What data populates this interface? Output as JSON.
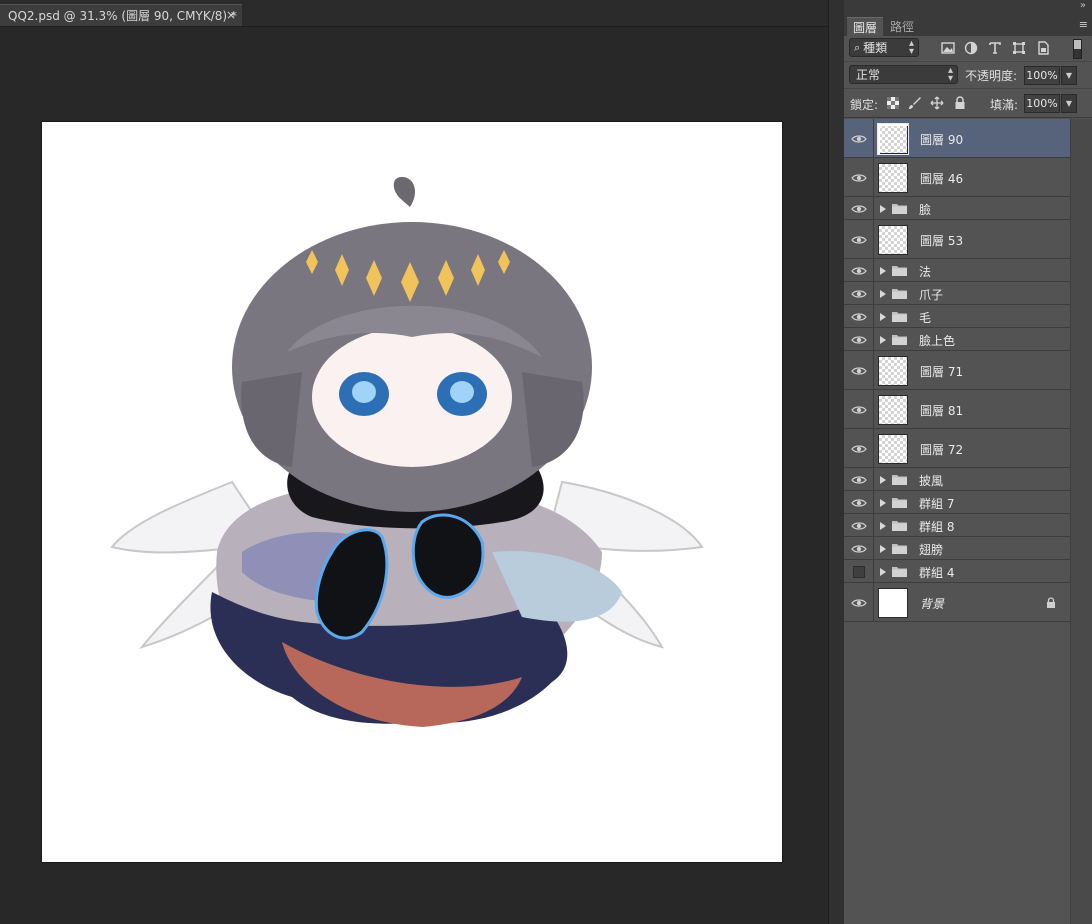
{
  "document": {
    "tab_title": "QQ2.psd @ 31.3% (圖層 90, CMYK/8) *",
    "tab_close": "×"
  },
  "panel": {
    "collapse_glyph": "»",
    "menu_glyph": "≡",
    "tabs": [
      {
        "label": "圖層",
        "active": true
      },
      {
        "label": "路徑",
        "active": false
      }
    ],
    "filter": {
      "kind_label": "種類",
      "icons": [
        "image-filter-icon",
        "adjustment-filter-icon",
        "type-filter-icon",
        "shape-filter-icon",
        "smart-object-filter-icon"
      ]
    },
    "blend": {
      "mode": "正常",
      "opacity_label": "不透明度:",
      "opacity_value": "100%"
    },
    "lock": {
      "label": "鎖定:",
      "fill_label": "填滿:",
      "fill_value": "100%"
    },
    "layers": [
      {
        "name": "圖層 90",
        "type": "layer",
        "visible": true,
        "selected": true
      },
      {
        "name": "圖層 46",
        "type": "layer",
        "visible": true
      },
      {
        "name": "臉",
        "type": "group",
        "visible": true
      },
      {
        "name": "圖層 53",
        "type": "layer",
        "visible": true
      },
      {
        "name": "法",
        "type": "group",
        "visible": true
      },
      {
        "name": "爪子",
        "type": "group",
        "visible": true
      },
      {
        "name": "毛",
        "type": "group",
        "visible": true
      },
      {
        "name": "臉上色",
        "type": "group",
        "visible": true
      },
      {
        "name": "圖層 71",
        "type": "layer",
        "visible": true
      },
      {
        "name": "圖層 81",
        "type": "layer",
        "visible": true
      },
      {
        "name": "圖層 72",
        "type": "layer",
        "visible": true
      },
      {
        "name": "披風",
        "type": "group",
        "visible": true
      },
      {
        "name": "群組 7",
        "type": "group",
        "visible": true
      },
      {
        "name": "群組 8",
        "type": "group",
        "visible": true
      },
      {
        "name": "翅膀",
        "type": "group",
        "visible": true
      },
      {
        "name": "群組 4",
        "type": "group",
        "visible": false
      },
      {
        "name": "背景",
        "type": "background",
        "visible": true,
        "locked": true
      }
    ]
  },
  "colors": {
    "workspace": "#282828",
    "panel": "#535353",
    "selected_row": "#56637a"
  }
}
